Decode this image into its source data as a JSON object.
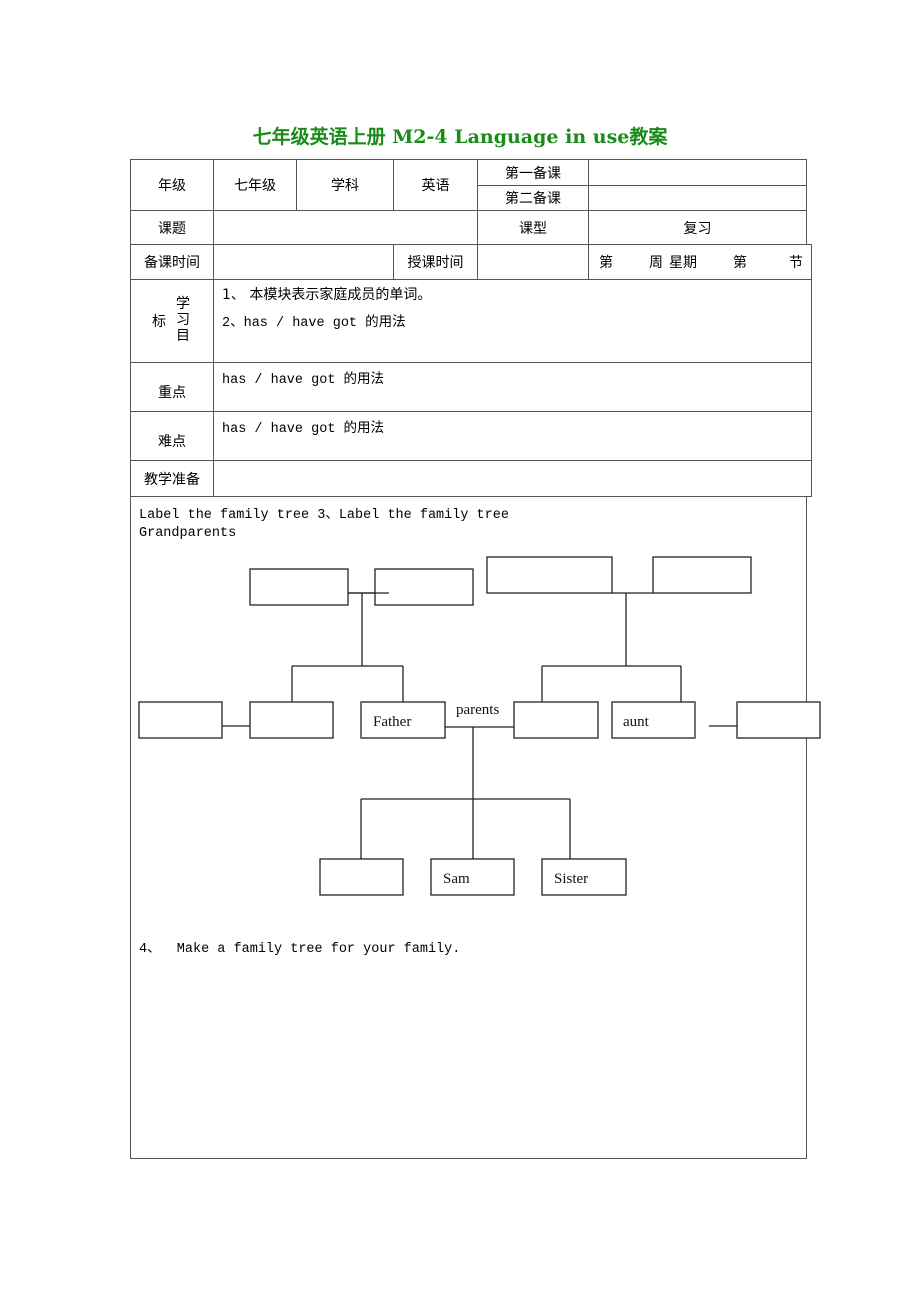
{
  "title": "七年级英语上册 M2-4 Language in use教案",
  "header_table": {
    "grade_label": "年级",
    "grade_value": "七年级",
    "subject_label": "学科",
    "subject_value": "英语",
    "first_prep_label": "第一备课",
    "first_prep_value": "",
    "second_prep_label": "第二备课",
    "second_prep_value": "",
    "topic_label": "课题",
    "topic_value": "",
    "lesson_type_label": "课型",
    "lesson_type_value": "复习",
    "prep_time_label": "备课时间",
    "prep_time_value": "",
    "teach_time_label": "授课时间",
    "teach_time_value": "",
    "schedule": {
      "week_prefix": "第",
      "week_suffix": "周",
      "weekday": "星期",
      "period_prefix": "第",
      "period_suffix": "节"
    }
  },
  "objectives": {
    "label_chars": [
      "学",
      "习",
      "目"
    ],
    "label_side": "标",
    "items": [
      "1、 本模块表示家庭成员的单词。",
      "2、has / have got 的用法"
    ]
  },
  "key_points": {
    "label": "重点",
    "value": "has / have got 的用法"
  },
  "difficulties": {
    "label": "难点",
    "value": "has / have got 的用法"
  },
  "teaching_prep": {
    "label": "教学准备",
    "value": ""
  },
  "tasks": {
    "task3_heading": "Label the family tree 3、Label the family tree",
    "task3_sub": "Grandparents",
    "task4": "4、  Make a family tree for your family."
  },
  "family_tree": {
    "grandparents_left": [
      "",
      ""
    ],
    "grandparents_right": [
      "",
      ""
    ],
    "generation2": [
      "",
      "",
      "Father",
      "",
      "aunt",
      ""
    ],
    "parents_label": "parents",
    "children": [
      "",
      "Sam",
      "Sister"
    ]
  }
}
